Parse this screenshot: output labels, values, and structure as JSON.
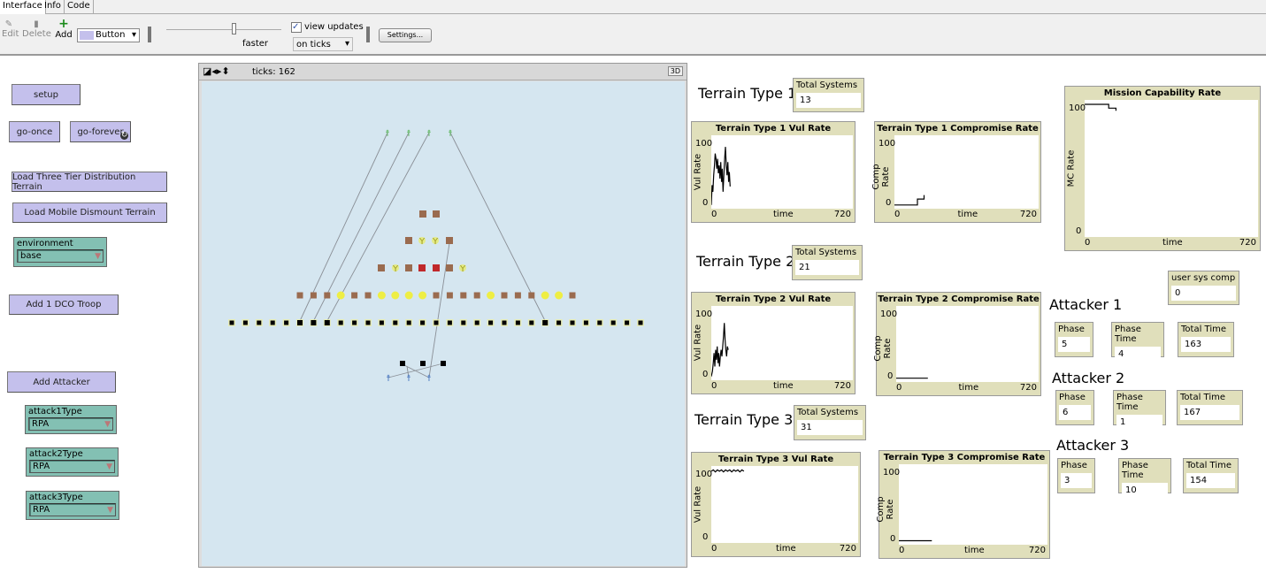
{
  "tabs": [
    "Interface",
    "Info",
    "Code"
  ],
  "toolbar": {
    "edit": "Edit",
    "delete": "Delete",
    "add": "Add",
    "widget_type": "Button",
    "speed_label": "faster",
    "speed_value": 0.5,
    "view_updates": "view updates",
    "view_updates_checked": true,
    "update_mode": "on ticks",
    "settings": "Settings..."
  },
  "view": {
    "ticks_label": "ticks: 162",
    "three_d": "3D"
  },
  "buttons": {
    "setup": "setup",
    "go_once": "go-once",
    "go_forever": "go-forever",
    "load_three": "Load Three Tier Distribution Terrain",
    "load_mobile": "Load Mobile Dismount Terrain",
    "add_dco": "Add 1 DCO Troop",
    "add_attacker": "Add Attacker"
  },
  "choosers": {
    "environment": {
      "label": "environment",
      "value": "base"
    },
    "attack1": {
      "label": "attack1Type",
      "value": "RPA"
    },
    "attack2": {
      "label": "attack2Type",
      "value": "RPA"
    },
    "attack3": {
      "label": "attack3Type",
      "value": "RPA"
    }
  },
  "terrain": [
    {
      "label": "Terrain Type 1",
      "total_label": "Total Systems",
      "total": "13"
    },
    {
      "label": "Terrain Type 2",
      "total_label": "Total Systems",
      "total": "21"
    },
    {
      "label": "Terrain Type 3",
      "total_label": "Total Systems",
      "total": "31"
    }
  ],
  "plots": [
    {
      "title": "Terrain Type 1 Vul Rate",
      "ylabel": "Vul Rate",
      "xlabel": "time",
      "xmin": "0",
      "xmax": "720",
      "ymin": "0",
      "ymax": "100",
      "points": [
        [
          0,
          0
        ],
        [
          4,
          30
        ],
        [
          8,
          20
        ],
        [
          12,
          45
        ],
        [
          16,
          60
        ],
        [
          20,
          78
        ],
        [
          24,
          70
        ],
        [
          28,
          55
        ],
        [
          32,
          70
        ],
        [
          36,
          48
        ],
        [
          40,
          60
        ],
        [
          44,
          40
        ],
        [
          48,
          65
        ],
        [
          52,
          35
        ],
        [
          56,
          55
        ],
        [
          60,
          20
        ],
        [
          64,
          45
        ],
        [
          68,
          70
        ],
        [
          72,
          88
        ],
        [
          76,
          60
        ],
        [
          80,
          45
        ],
        [
          84,
          65
        ],
        [
          88,
          35
        ],
        [
          92,
          50
        ],
        [
          96,
          28
        ]
      ]
    },
    {
      "title": "Terrain Type 1 Compromise Rate",
      "ylabel": "Comp Rate",
      "xlabel": "time",
      "xmin": "0",
      "xmax": "720",
      "ymin": "0",
      "ymax": "100",
      "points": [
        [
          0,
          0
        ],
        [
          115,
          0
        ],
        [
          115,
          9
        ],
        [
          148,
          9
        ],
        [
          148,
          15
        ]
      ]
    },
    {
      "title": "Mission Capability Rate",
      "ylabel": "MC Rate",
      "xlabel": "time",
      "xmin": "0",
      "xmax": "720",
      "ymin": "0",
      "ymax": "100",
      "points": [
        [
          0,
          100
        ],
        [
          100,
          100
        ],
        [
          100,
          97
        ],
        [
          130,
          97
        ],
        [
          130,
          95
        ]
      ]
    },
    {
      "title": "Terrain Type 2 Vul Rate",
      "ylabel": "Vul Rate",
      "xlabel": "time",
      "xmin": "0",
      "xmax": "720",
      "ymin": "0",
      "ymax": "100",
      "points": [
        [
          0,
          0
        ],
        [
          6,
          8
        ],
        [
          10,
          20
        ],
        [
          14,
          35
        ],
        [
          18,
          15
        ],
        [
          22,
          40
        ],
        [
          26,
          25
        ],
        [
          30,
          45
        ],
        [
          34,
          20
        ],
        [
          38,
          35
        ],
        [
          42,
          15
        ],
        [
          46,
          30
        ],
        [
          50,
          40
        ],
        [
          54,
          30
        ],
        [
          58,
          45
        ],
        [
          62,
          60
        ],
        [
          66,
          80
        ],
        [
          70,
          55
        ],
        [
          74,
          40
        ],
        [
          78,
          30
        ],
        [
          82,
          45
        ],
        [
          86,
          40
        ]
      ]
    },
    {
      "title": "Terrain Type 2 Compromise Rate",
      "ylabel": "Comp Rate",
      "xlabel": "time",
      "xmin": "0",
      "xmax": "720",
      "ymin": "0",
      "ymax": "100",
      "points": [
        [
          0,
          0
        ],
        [
          160,
          0
        ]
      ]
    },
    {
      "title": "Terrain Type 3 Vul Rate",
      "ylabel": "Vul Rate",
      "xlabel": "time",
      "xmin": "0",
      "xmax": "720",
      "ymin": "0",
      "ymax": "100",
      "points": [
        [
          0,
          98
        ],
        [
          10,
          100
        ],
        [
          20,
          97
        ],
        [
          30,
          100
        ],
        [
          40,
          98
        ],
        [
          50,
          100
        ],
        [
          60,
          97
        ],
        [
          70,
          100
        ],
        [
          80,
          98
        ],
        [
          90,
          100
        ],
        [
          100,
          97
        ],
        [
          110,
          100
        ],
        [
          120,
          98
        ],
        [
          130,
          100
        ],
        [
          140,
          97
        ],
        [
          150,
          100
        ],
        [
          160,
          98
        ]
      ]
    },
    {
      "title": "Terrain Type 3 Compromise Rate",
      "ylabel": "Comp Rate",
      "xlabel": "time",
      "xmin": "0",
      "xmax": "720",
      "ymin": "0",
      "ymax": "100",
      "points": [
        [
          0,
          0
        ],
        [
          160,
          0
        ]
      ]
    }
  ],
  "user_sys_comp": {
    "label": "user sys comp",
    "value": "0"
  },
  "attackers": [
    {
      "label": "Attacker 1",
      "phase_label": "Phase",
      "phase": "5",
      "phase_time_label": "Phase Time",
      "phase_time": "4",
      "total_time_label": "Total Time",
      "total_time": "163"
    },
    {
      "label": "Attacker 2",
      "phase_label": "Phase",
      "phase": "6",
      "phase_time_label": "Phase Time",
      "phase_time": "1",
      "total_time_label": "Total Time",
      "total_time": "167"
    },
    {
      "label": "Attacker 3",
      "phase_label": "Phase",
      "phase": "3",
      "phase_time_label": "Phase Time",
      "phase_time": "10",
      "total_time_label": "Total Time",
      "total_time": "154"
    }
  ],
  "colors": {
    "button": "#c4c0ec",
    "chooser": "#83c0b3",
    "monitor": "#e0dfbb",
    "world": "#d5e6f0",
    "brown": "#9a6b4f",
    "yellow": "#eeee44",
    "red": "#c0282a",
    "green_person": "#5bb55b",
    "blue_person": "#4a78c0"
  }
}
